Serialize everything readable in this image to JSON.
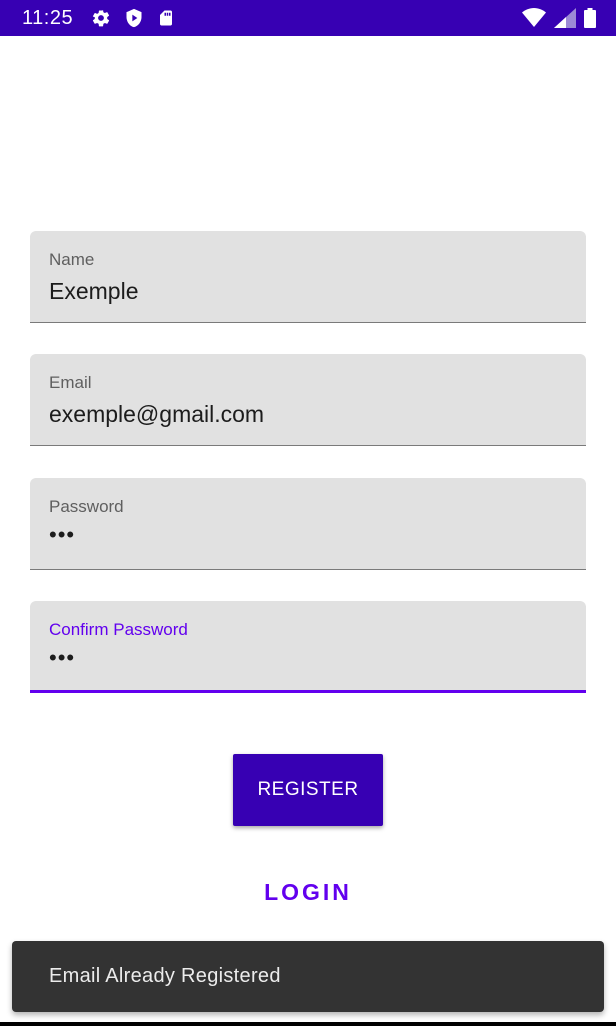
{
  "status_bar": {
    "time": "11:25",
    "left_icons": [
      "gear-icon",
      "shield-play-icon",
      "sd-card-icon"
    ],
    "right_icons": [
      "wifi-icon",
      "cell-signal-icon",
      "battery-icon"
    ],
    "background_color": "#3700b3"
  },
  "form": {
    "name": {
      "label": "Name",
      "value": "Exemple"
    },
    "email": {
      "label": "Email",
      "value": "exemple@gmail.com"
    },
    "password": {
      "label": "Password",
      "value": "•••"
    },
    "confirm_password": {
      "label": "Confirm Password",
      "value": "•••",
      "focused": true
    }
  },
  "actions": {
    "register_label": "REGISTER",
    "login_label": "LOGIN"
  },
  "snackbar": {
    "message": "Email Already Registered"
  },
  "colors": {
    "primary": "#6200ee",
    "primary_dark": "#3700b3",
    "field_background": "#e1e1e1",
    "snackbar_background": "#333333"
  }
}
